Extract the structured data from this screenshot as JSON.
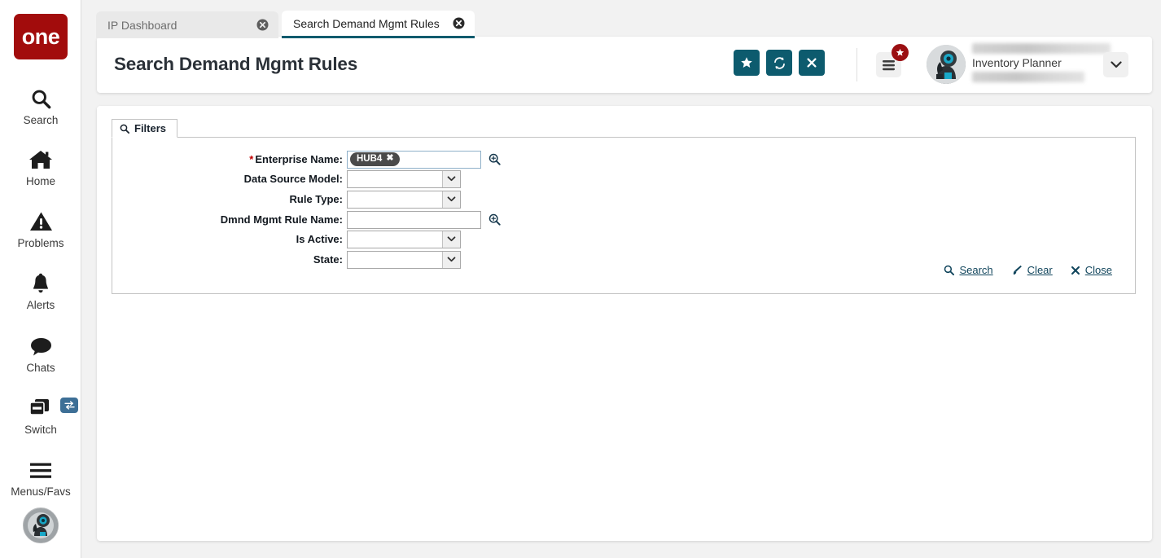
{
  "brand": {
    "logo_text": "one"
  },
  "sidebar": {
    "items": [
      {
        "label": "Search",
        "icon": "search-icon"
      },
      {
        "label": "Home",
        "icon": "home-icon"
      },
      {
        "label": "Problems",
        "icon": "warning-triangle-icon"
      },
      {
        "label": "Alerts",
        "icon": "bell-icon"
      },
      {
        "label": "Chats",
        "icon": "chat-bubble-icon"
      },
      {
        "label": "Switch",
        "icon": "windows-switch-icon",
        "badge_icon": "exchange-arrows-icon"
      },
      {
        "label": "Menus/Favs",
        "icon": "hamburger-icon"
      }
    ],
    "avatar_name": "user-avatar-image"
  },
  "tabs": [
    {
      "label": "IP Dashboard",
      "active": false,
      "close_icon": "close-circle-icon"
    },
    {
      "label": "Search Demand Mgmt Rules",
      "active": true,
      "close_icon": "close-circle-icon"
    }
  ],
  "header": {
    "title": "Search Demand Mgmt Rules",
    "actions": [
      {
        "name": "favorite-button",
        "icon": "star-icon"
      },
      {
        "name": "refresh-button",
        "icon": "refresh-icon"
      },
      {
        "name": "close-button",
        "icon": "x-icon"
      }
    ],
    "menu_fav_icon": "hamburger-menu-icon",
    "menu_fav_badge_icon": "star-icon",
    "user": {
      "name_redacted": "",
      "role": "Inventory Planner",
      "org_redacted": "",
      "dropdown_icon": "chevron-down-icon"
    }
  },
  "filters": {
    "tab_label": "Filters",
    "tab_icon": "search-icon",
    "fields": [
      {
        "label": "Enterprise Name:",
        "required": true,
        "type": "token-input",
        "tokens": [
          {
            "text": "HUB4",
            "remove_icon": "x-icon"
          }
        ],
        "lookup_icon": "magnifier-plus-icon"
      },
      {
        "label": "Data Source Model:",
        "required": false,
        "type": "select",
        "value": "",
        "caret_icon": "chevron-down-icon"
      },
      {
        "label": "Rule Type:",
        "required": false,
        "type": "select",
        "value": "",
        "caret_icon": "chevron-down-icon"
      },
      {
        "label": "Dmnd Mgmt Rule Name:",
        "required": false,
        "type": "text",
        "value": "",
        "lookup_icon": "magnifier-plus-icon"
      },
      {
        "label": "Is Active:",
        "required": false,
        "type": "select",
        "value": "",
        "caret_icon": "chevron-down-icon"
      },
      {
        "label": "State:",
        "required": false,
        "type": "select",
        "value": "",
        "caret_icon": "chevron-down-icon"
      }
    ],
    "actions": [
      {
        "label": "Search",
        "icon": "search-icon"
      },
      {
        "label": "Clear",
        "icon": "eraser-icon"
      },
      {
        "label": "Close",
        "icon": "x-icon"
      }
    ]
  },
  "colors": {
    "brand_red": "#a20c0c",
    "teal": "#0d5b6e",
    "link": "#11455c",
    "badge_red": "#9b0f12",
    "switch_badge_blue": "#3d6f96",
    "token_gray": "#4a4a4a"
  }
}
